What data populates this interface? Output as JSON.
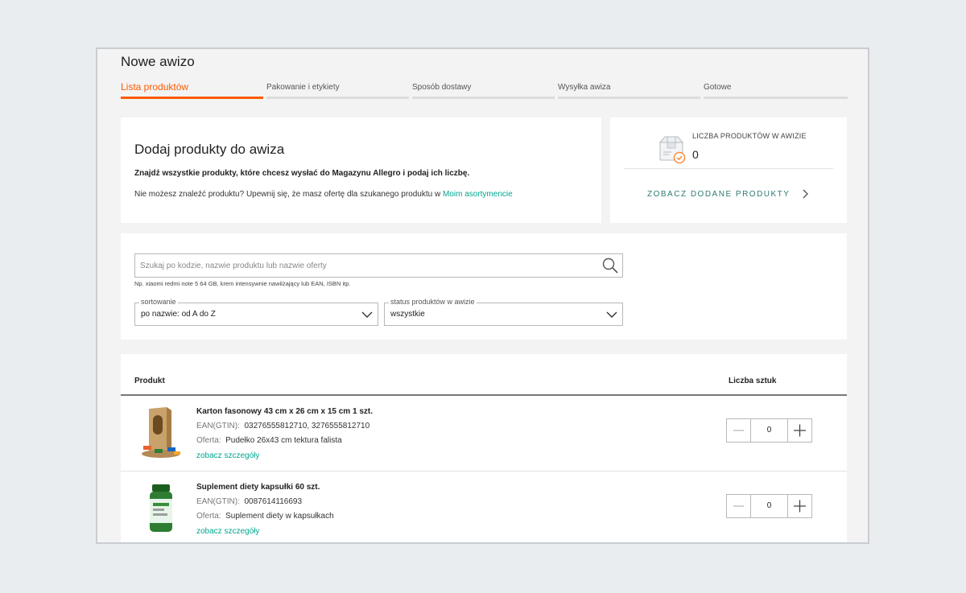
{
  "page": {
    "title": "Nowe awizo"
  },
  "steps": [
    {
      "label": "Lista produktów",
      "active": true
    },
    {
      "label": "Pakowanie i etykiety",
      "active": false
    },
    {
      "label": "Sposób dostawy",
      "active": false
    },
    {
      "label": "Wysyłka awiza",
      "active": false
    },
    {
      "label": "Gotowe",
      "active": false
    }
  ],
  "intro": {
    "heading": "Dodaj produkty do awiza",
    "bold_text": "Znajdź wszystkie produkty, które chcesz wysłać do Magazynu Allegro i podaj ich liczbę.",
    "info_text": "Nie możesz znaleźć produktu? Upewnij się, że masz ofertę dla szukanego produktu w ",
    "info_link": "Moim asortymencie"
  },
  "summary": {
    "label": "LICZBA PRODUKTÓW W AWIZIE",
    "count": "0",
    "see_all": "ZOBACZ DODANE PRODUKTY"
  },
  "search": {
    "placeholder": "Szukaj po kodzie, nazwie produktu lub nazwie oferty",
    "value": "",
    "hint": "Np. xiaomi redmi note 5 64 GB, krem intensywnie nawilżający lub EAN, ISBN itp."
  },
  "filters": {
    "sort": {
      "label": "sortowanie",
      "value": "po nazwie: od A do Z"
    },
    "status": {
      "label": "status produktów w awizie",
      "value": "wszystkie"
    }
  },
  "table": {
    "col_product": "Produkt",
    "col_qty": "Liczba sztuk",
    "rows": [
      {
        "name": "Karton fasonowy 43 cm x 26 cm x 15 cm 1 szt.",
        "ean_label": "EAN(GTIN):",
        "ean": "03276555812710, 3276555812710",
        "offer_label": "Oferta:",
        "offer": "Pudełko 26x43 cm tektura falista",
        "details": "zobacz szczegóły",
        "qty": "0"
      },
      {
        "name": "Suplement diety kapsułki 60 szt.",
        "ean_label": "EAN(GTIN):",
        "ean": "0087614116693",
        "offer_label": "Oferta:",
        "offer": "Suplement diety w kapsułkach",
        "details": "zobacz szczegóły",
        "qty": "0"
      }
    ]
  },
  "colors": {
    "accent": "#ff5a00",
    "link": "#00a790",
    "background": "#e9edf0"
  }
}
